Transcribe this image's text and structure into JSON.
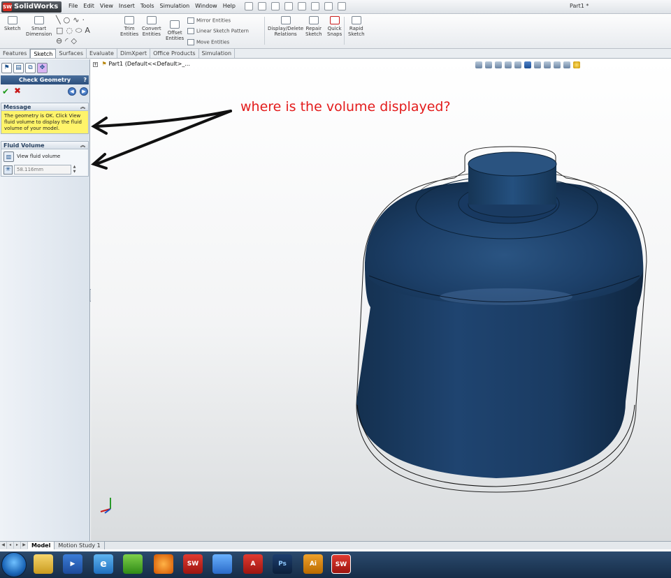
{
  "app": {
    "name": "SolidWorks",
    "logo_mark": "SW",
    "document_title": "Part1 *"
  },
  "menu": [
    "File",
    "Edit",
    "View",
    "Insert",
    "Tools",
    "Simulation",
    "Window",
    "Help"
  ],
  "ribbon": {
    "sketch": "Sketch",
    "smart_dimension_1": "Smart",
    "smart_dimension_2": "Dimension",
    "trim_1": "Trim",
    "trim_2": "Entities",
    "convert_1": "Convert",
    "convert_2": "Entities",
    "offset_1": "Offset",
    "offset_2": "Entities",
    "mirror": "Mirror Entities",
    "linear_pattern": "Linear Sketch Pattern",
    "move": "Move Entities",
    "display_delete_1": "Display/Delete",
    "display_delete_2": "Relations",
    "repair_1": "Repair",
    "repair_2": "Sketch",
    "quick_snaps_1": "Quick",
    "quick_snaps_2": "Snaps",
    "rapid_sketch_1": "Rapid",
    "rapid_sketch_2": "Sketch"
  },
  "tabs": [
    "Features",
    "Sketch",
    "Surfaces",
    "Evaluate",
    "DimXpert",
    "Office Products",
    "Simulation"
  ],
  "property_manager": {
    "title": "Check Geometry",
    "help": "?",
    "message_header": "Message",
    "message_text": "The geometry is OK. Click View fluid volume to display the fluid volume of your model.",
    "fluid_volume_header": "Fluid Volume",
    "view_fluid_volume": "View fluid volume",
    "distance_value": "58.116mm"
  },
  "tree": {
    "root": "Part1  (Default<<Default>_..."
  },
  "annotation": "where is the volume displayed?",
  "bottom_tabs": [
    "Model",
    "Motion Study 1"
  ],
  "taskbar": [
    "Explorer",
    "Media Player",
    "Internet Explorer",
    "Chrome",
    "Firefox",
    "SolidWorks",
    "App",
    "Acrobat",
    "Ps",
    "Ai",
    "SolidWorks"
  ],
  "colors": {
    "part": "#1e3f66",
    "annotation": "#e31b1b",
    "message_bg": "#fff46a"
  }
}
